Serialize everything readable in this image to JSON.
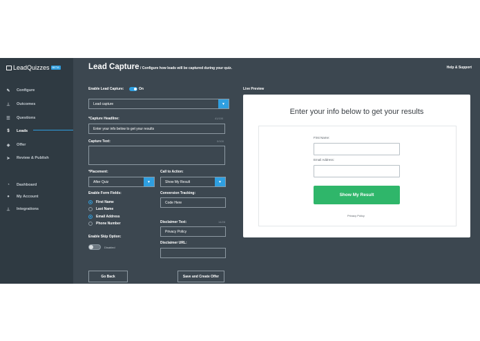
{
  "app": {
    "logo_text": "LeadQuizzes",
    "logo_badge": "BETA"
  },
  "sidebar": {
    "items": [
      {
        "label": "Configure",
        "icon": "pencil-icon",
        "glyph": "✎"
      },
      {
        "label": "Outcomes",
        "icon": "tree-icon",
        "glyph": "⊥"
      },
      {
        "label": "Questions",
        "icon": "list-icon",
        "glyph": "☰"
      },
      {
        "label": "Leads",
        "icon": "funnel-icon",
        "glyph": "$"
      },
      {
        "label": "Offer",
        "icon": "tag-icon",
        "glyph": "◈"
      },
      {
        "label": "Review & Publish",
        "icon": "send-icon",
        "glyph": "➤"
      },
      {
        "label": "Dashboard",
        "icon": "gauge-icon",
        "glyph": "◔"
      },
      {
        "label": "My Account",
        "icon": "user-icon",
        "glyph": "●"
      },
      {
        "label": "Integrations",
        "icon": "tree-icon",
        "glyph": "⊥"
      }
    ],
    "active_index": 3
  },
  "header": {
    "title": "Lead Capture",
    "subtitle": "/  Configure how leads will be captured during your quiz.",
    "help": "Help & Support"
  },
  "form": {
    "enable_label": "Enable Lead Capture:",
    "enable_state": "On",
    "capture_select": "Lead capture",
    "headline_label": "*Capture Headline:",
    "headline_count": "41/100",
    "headline_value": "Enter your info below to get your results",
    "text_label": "Capture Text:",
    "text_count": "0/100",
    "text_value": "",
    "placement_label": "*Placement:",
    "placement_value": "After Quiz",
    "cta_label": "Call to Action:",
    "cta_value": "Show My Result",
    "fields_label": "Enable Form Fields:",
    "fields": [
      {
        "label": "First Name",
        "checked": true
      },
      {
        "label": "Last Name",
        "checked": false
      },
      {
        "label": "Email Address",
        "checked": true
      },
      {
        "label": "Phone Number",
        "checked": false
      }
    ],
    "tracking_label": "Conversion Tracking:",
    "tracking_value": "Code Here",
    "disclaimer_label": "Disclaimer Text:",
    "disclaimer_count": "14/28",
    "disclaimer_value": "Privacy Policy",
    "disclaimer_url_label": "Disclaimer URL:",
    "disclaimer_url_value": "",
    "skip_label": "Enable Skip Option:",
    "skip_state": "Disabled",
    "back_button": "Go Back",
    "save_button": "Save and Create Offer"
  },
  "preview": {
    "label": "Live Preview",
    "headline": "Enter your info below to get your results",
    "first_name_label": "First Name:",
    "email_label": "Email Address:",
    "button": "Show My Result",
    "privacy": "Privacy Policy"
  },
  "colors": {
    "accent": "#2f9fe0",
    "cta_green": "#2fb66a",
    "sidebar_bg": "#2f3a42",
    "main_bg": "#3c4750"
  }
}
